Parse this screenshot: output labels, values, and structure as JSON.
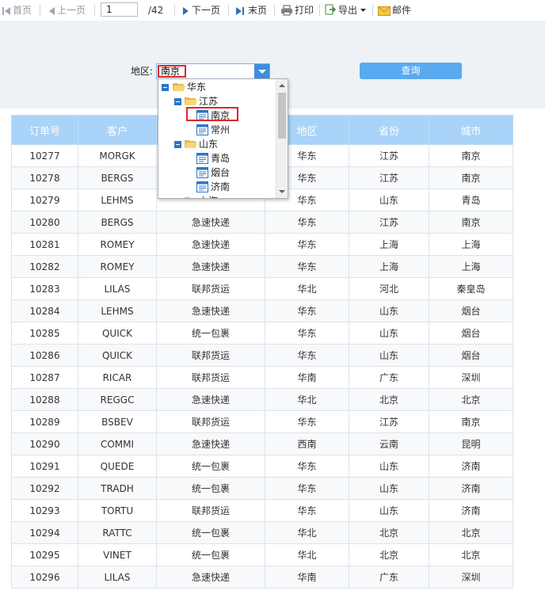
{
  "toolbar": {
    "first": "首页",
    "prev": "上一页",
    "page_current": "1",
    "page_total": "/42",
    "next": "下一页",
    "last": "末页",
    "print": "打印",
    "export": "导出",
    "mail": "邮件"
  },
  "params": {
    "region_label": "地区:",
    "region_value": "南京",
    "query_label": "查询"
  },
  "tree": {
    "n0": "华东",
    "n1": "江苏",
    "n2": "南京",
    "n3": "常州",
    "n4": "山东",
    "n5": "青岛",
    "n6": "烟台",
    "n7": "济南",
    "n8": "上海"
  },
  "table": {
    "headers": [
      "订单号",
      "客户",
      "",
      "地区",
      "省份",
      "城市"
    ],
    "rows": [
      [
        "10277",
        "MORGK",
        "",
        "华东",
        "江苏",
        "南京"
      ],
      [
        "10278",
        "BERGS",
        "",
        "华东",
        "江苏",
        "南京"
      ],
      [
        "10279",
        "LEHMS",
        "",
        "华东",
        "山东",
        "青岛"
      ],
      [
        "10280",
        "BERGS",
        "急速快递",
        "华东",
        "江苏",
        "南京"
      ],
      [
        "10281",
        "ROMEY",
        "急速快递",
        "华东",
        "上海",
        "上海"
      ],
      [
        "10282",
        "ROMEY",
        "急速快递",
        "华东",
        "上海",
        "上海"
      ],
      [
        "10283",
        "LILAS",
        "联邦货运",
        "华北",
        "河北",
        "秦皇岛"
      ],
      [
        "10284",
        "LEHMS",
        "急速快递",
        "华东",
        "山东",
        "烟台"
      ],
      [
        "10285",
        "QUICK",
        "统一包裹",
        "华东",
        "山东",
        "烟台"
      ],
      [
        "10286",
        "QUICK",
        "联邦货运",
        "华东",
        "山东",
        "烟台"
      ],
      [
        "10287",
        "RICAR",
        "联邦货运",
        "华南",
        "广东",
        "深圳"
      ],
      [
        "10288",
        "REGGC",
        "急速快递",
        "华北",
        "北京",
        "北京"
      ],
      [
        "10289",
        "BSBEV",
        "联邦货运",
        "华东",
        "江苏",
        "南京"
      ],
      [
        "10290",
        "COMMI",
        "急速快递",
        "西南",
        "云南",
        "昆明"
      ],
      [
        "10291",
        "QUEDE",
        "统一包裹",
        "华东",
        "山东",
        "济南"
      ],
      [
        "10292",
        "TRADH",
        "统一包裹",
        "华东",
        "山东",
        "济南"
      ],
      [
        "10293",
        "TORTU",
        "联邦货运",
        "华东",
        "山东",
        "济南"
      ],
      [
        "10294",
        "RATTC",
        "统一包裹",
        "华北",
        "北京",
        "北京"
      ],
      [
        "10295",
        "VINET",
        "统一包裹",
        "华北",
        "北京",
        "北京"
      ],
      [
        "10296",
        "LILAS",
        "急速快递",
        "华南",
        "广东",
        "深圳"
      ]
    ]
  },
  "colors": {
    "header_bg": "#a9d3f8",
    "accent": "#3d8fde",
    "highlight": "#e0242b"
  }
}
